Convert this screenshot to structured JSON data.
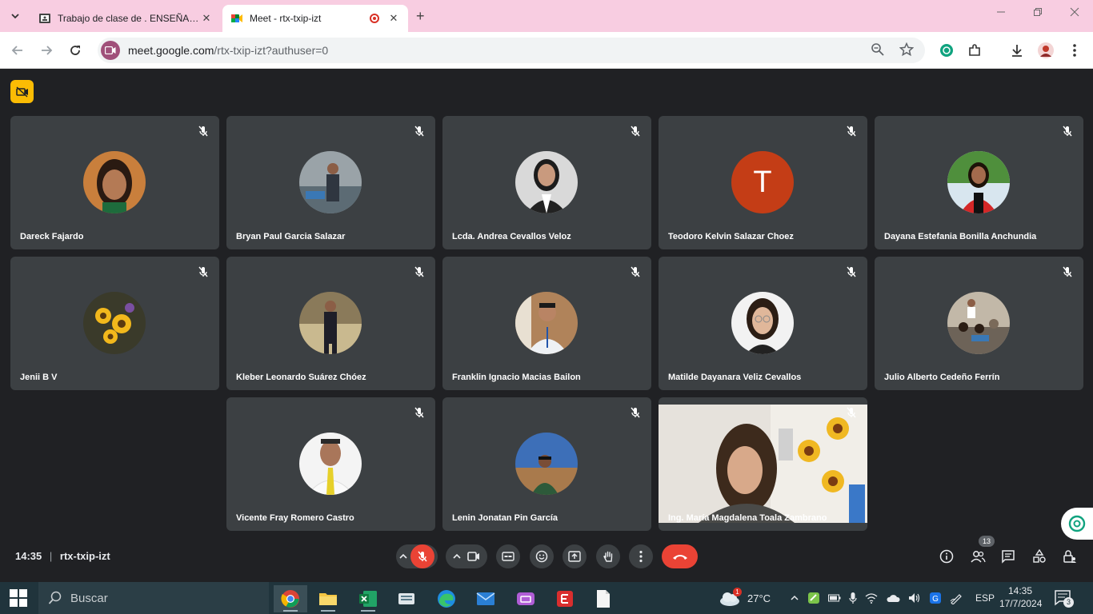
{
  "browser": {
    "tabs": [
      {
        "title": "Trabajo de clase de . ENSEÑANZA",
        "active": false,
        "close": "✕"
      },
      {
        "title": "Meet - rtx-txip-izt",
        "active": true,
        "close": "✕",
        "recording": true
      }
    ],
    "new_tab": "+",
    "url_host": "meet.google.com",
    "url_path": "/rtx-txip-izt?authuser=0"
  },
  "meet": {
    "participants": [
      {
        "name": "Dareck Fajardo",
        "avatar": "photo-woman-dark-hair"
      },
      {
        "name": "Bryan Paul Garcia Salazar",
        "avatar": "photo-man-suit"
      },
      {
        "name": "Lcda. Andrea Cevallos Veloz",
        "avatar": "photo-woman-blazer"
      },
      {
        "name": "Teodoro Kelvin Salazar Choez",
        "avatar_letter": "T",
        "avatar_color": "#c43d16"
      },
      {
        "name": "Dayana Estefania Bonilla Anchundia",
        "avatar": "photo-woman-red-jacket"
      },
      {
        "name": "Jenii B V",
        "avatar": "photo-sunflowers"
      },
      {
        "name": "Kleber Leonardo Suárez Chóez",
        "avatar": "photo-man-standing"
      },
      {
        "name": "Franklin Ignacio Macias Bailon",
        "avatar": "photo-man-glasses"
      },
      {
        "name": "Matilde Dayanara Veliz Cevallos",
        "avatar": "photo-woman-glasses"
      },
      {
        "name": "Julio Alberto Cedeño Ferrín",
        "avatar": "photo-group"
      },
      {
        "name": "Vicente Fray Romero Castro",
        "avatar": "photo-man-tie"
      },
      {
        "name": "Lenin Jonatan Pin García",
        "avatar": "photo-man-landscape"
      },
      {
        "name": "Ing. María Magdalena Toala Zambrano",
        "video": true
      }
    ],
    "time": "14:35",
    "meeting_code": "rtx-txip-izt",
    "separator": "|",
    "participant_count": "13"
  },
  "taskbar": {
    "search_placeholder": "Buscar",
    "weather": "27°C",
    "weather_badge": "1",
    "language": "ESP",
    "clock_time": "14:35",
    "clock_date": "17/7/2024",
    "notifications": "3"
  },
  "colors": {
    "meet_bg": "#202124",
    "tile_bg": "#3c4043",
    "end_call": "#ea4335",
    "camera_warning": "#fbbc04",
    "tabbar": "#f8cde1"
  }
}
